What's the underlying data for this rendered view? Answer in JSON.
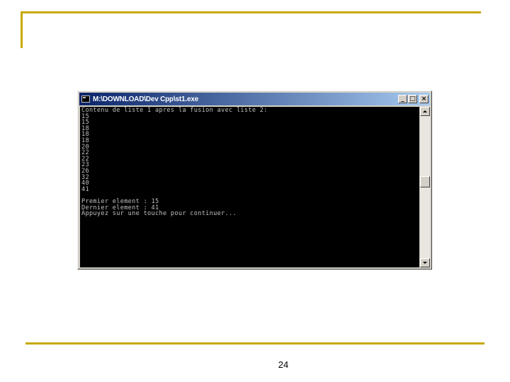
{
  "window": {
    "title": "M:\\DOWNLOAD\\Dev Cpp\\st1.exe",
    "buttons": {
      "minimize": "_",
      "maximize": "□",
      "close": "×"
    }
  },
  "console": {
    "lines": [
      "Contenu de liste 1 apres la fusion avec liste 2:",
      "15",
      "15",
      "18",
      "18",
      "18",
      "20",
      "22",
      "22",
      "23",
      "26",
      "32",
      "40",
      "41",
      "",
      "Premier element : 15",
      "Dernier element : 41",
      "Appuyez sur une touche pour continuer..."
    ]
  },
  "slide": {
    "page_number": "24"
  },
  "colors": {
    "accent_rule": "#c8a800",
    "title_gradient_start": "#0a246a",
    "title_gradient_end": "#a6caf0",
    "console_bg": "#000000",
    "console_fg": "#c0c0c0"
  }
}
